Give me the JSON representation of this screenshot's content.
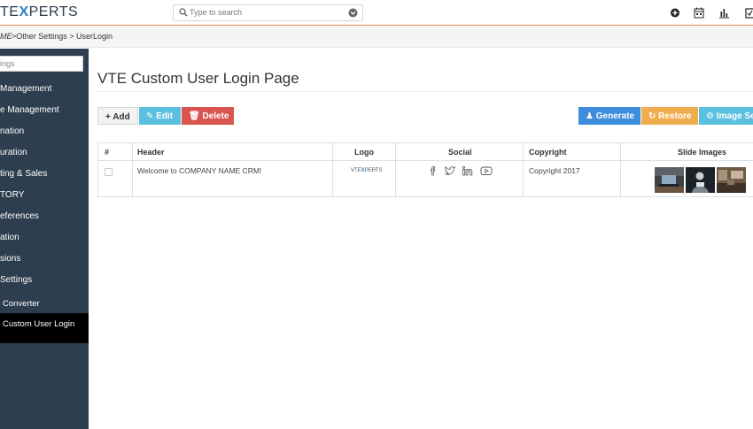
{
  "app": {
    "logo_prefix": "TE",
    "logo_x": "X",
    "logo_suffix": "PERTS"
  },
  "search": {
    "placeholder": "Type to search"
  },
  "breadcrumb": {
    "home": "ME",
    "path": ">Other Settings > UserLogin"
  },
  "sidebar": {
    "search_placeholder": "ttings",
    "items": [
      {
        "label": "Management"
      },
      {
        "label": "e Management"
      },
      {
        "label": "nation"
      },
      {
        "label": "uration"
      },
      {
        "label": "ting & Sales"
      },
      {
        "label": "TORY"
      },
      {
        "label": "eferences"
      },
      {
        "label": "ation"
      },
      {
        "label": "sions"
      },
      {
        "label": " Settings"
      },
      {
        "label": "Converter"
      },
      {
        "label": "Custom User Login",
        "active": true
      }
    ]
  },
  "page": {
    "title": "VTE Custom User Login Page"
  },
  "toolbar": {
    "add_label": "+ Add",
    "edit_label": "✎ Edit",
    "delete_label": "🗑 Delete",
    "generate_label": "♟ Generate",
    "restore_label": "↻ Restore",
    "image_settings_label": "⚙ Image Se"
  },
  "table": {
    "columns": [
      "#",
      "Header",
      "Logo",
      "Social",
      "Copyright",
      "Slide Images"
    ],
    "rows": [
      {
        "header": "Welcome to COMPANY NAME CRM!",
        "logo_prefix": "VTE",
        "logo_x": "X",
        "logo_suffix": "PERTS",
        "social_icons": [
          "facebook-icon",
          "twitter-icon",
          "linkedin-icon",
          "youtube-icon"
        ],
        "copyright": "Copyright 2017"
      }
    ]
  },
  "colors": {
    "sidebar_bg": "#2d3e4e",
    "accent_orange": "#e8874b",
    "logo_blue": "#2a7fc1",
    "edit": "#5bc0de",
    "delete": "#d9534f",
    "generate": "#3c8dde",
    "restore": "#f0ad4e"
  }
}
